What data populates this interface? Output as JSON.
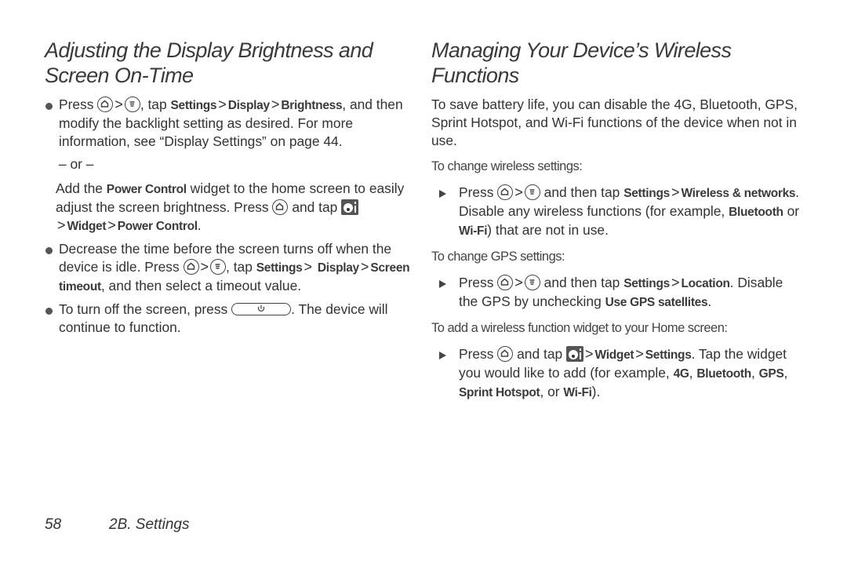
{
  "left": {
    "title_line1": "Adjusting the Display Brightness and",
    "title_line2": "Screen On-Time",
    "bullet1": {
      "t1": "Press",
      "t2": ", tap",
      "b1": "Settings",
      "b2": "Display",
      "b3": "Brightness",
      "t3": ", and then modify the backlight setting as desired. For more information, see “Display Settings” on page 44."
    },
    "or": "– or –",
    "alt": {
      "t1": "Add the",
      "b1": "Power Control",
      "t2": "widget to the home screen to easily adjust the screen brightness. Press",
      "t3": "and tap",
      "b2": "Widget",
      "b3": "Power Control",
      "t4": "."
    },
    "bullet2": {
      "t1": "Decrease the time before the screen turns off when the device is idle. Press",
      "t2": ", tap",
      "b1": "Settings",
      "b2": "Display",
      "b3": "Screen timeout",
      "t3": ", and then select a timeout value."
    },
    "bullet3": {
      "t1": "To turn off the screen, press",
      "t2": ". The device will continue to function."
    }
  },
  "right": {
    "title_line1": "Managing Your Device’s Wireless",
    "title_line2": "Functions",
    "intro": "To save battery life, you can disable the 4G, Bluetooth, GPS, Sprint Hotspot, and Wi-Fi functions of the device when not in use.",
    "sub1": "To change wireless settings:",
    "step1": {
      "t1": "Press",
      "t2": "and then tap",
      "b1": "Settings",
      "b2": "Wireless & networks",
      "t3": ". Disable any wireless functions (for example,",
      "b3": "Bluetooth",
      "t4": "or",
      "b4": "Wi-Fi",
      "t5": ") that are not in use."
    },
    "sub2": "To change GPS settings:",
    "step2": {
      "t1": "Press",
      "t2": "and then tap",
      "b1": "Settings",
      "b2": "Location",
      "t3": ". Disable the GPS by unchecking",
      "b3": "Use GPS satellites",
      "t4": "."
    },
    "sub3": "To add a wireless function widget to your Home screen:",
    "step3": {
      "t1": "Press",
      "t2": "and tap",
      "b1": "Widget",
      "b2": "Settings",
      "t3": ". Tap the widget you would like to add (for example,",
      "b3": "4G",
      "b4": "Bluetooth",
      "b5": "GPS",
      "b6": "Sprint Hotspot",
      "t4": ", or",
      "b7": "Wi-Fi",
      "t5": ")."
    }
  },
  "separator": ">",
  "comma": ",",
  "footer": {
    "page_number": "58",
    "section": "2B. Settings"
  }
}
